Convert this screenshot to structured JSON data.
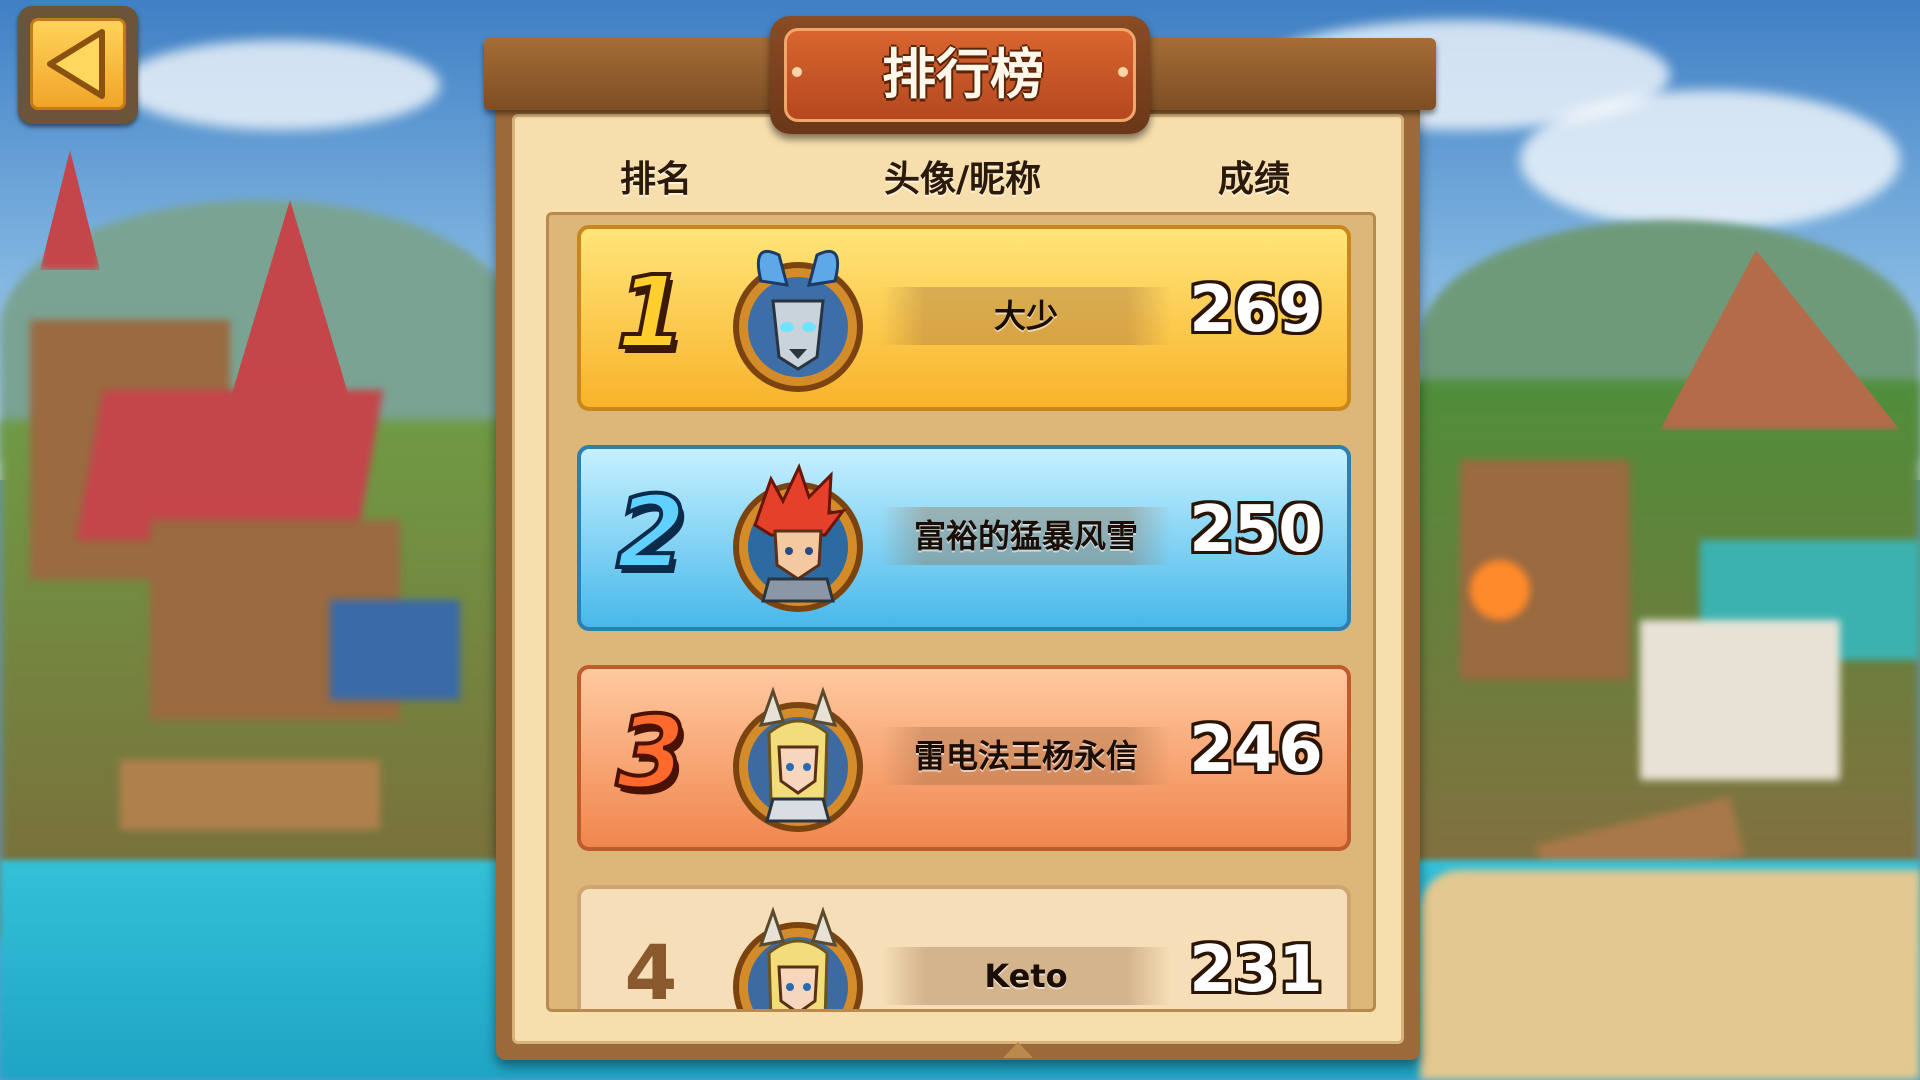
{
  "header": {
    "title": "排行榜",
    "back_icon": "triangle-left-icon"
  },
  "columns": {
    "rank": "排名",
    "avatar_name": "头像/昵称",
    "score": "成绩"
  },
  "leaderboard": [
    {
      "rank": "1",
      "name": "大少",
      "score": "269",
      "avatar_icon": "horned-dark-knight-avatar-icon",
      "style": "gold"
    },
    {
      "rank": "2",
      "name": "富裕的猛暴风雪",
      "score": "250",
      "avatar_icon": "red-haired-hero-avatar-icon",
      "style": "blue"
    },
    {
      "rank": "3",
      "name": "雷电法王杨永信",
      "score": "246",
      "avatar_icon": "valkyrie-avatar-icon",
      "style": "orange"
    },
    {
      "rank": "4",
      "name": "Keto",
      "score": "231",
      "avatar_icon": "valkyrie-avatar-icon",
      "style": "plain"
    }
  ],
  "colors": {
    "gold": "#f8b32a",
    "blue": "#48b8ea",
    "orange": "#f0864e",
    "title_plate": "#c9552a"
  }
}
